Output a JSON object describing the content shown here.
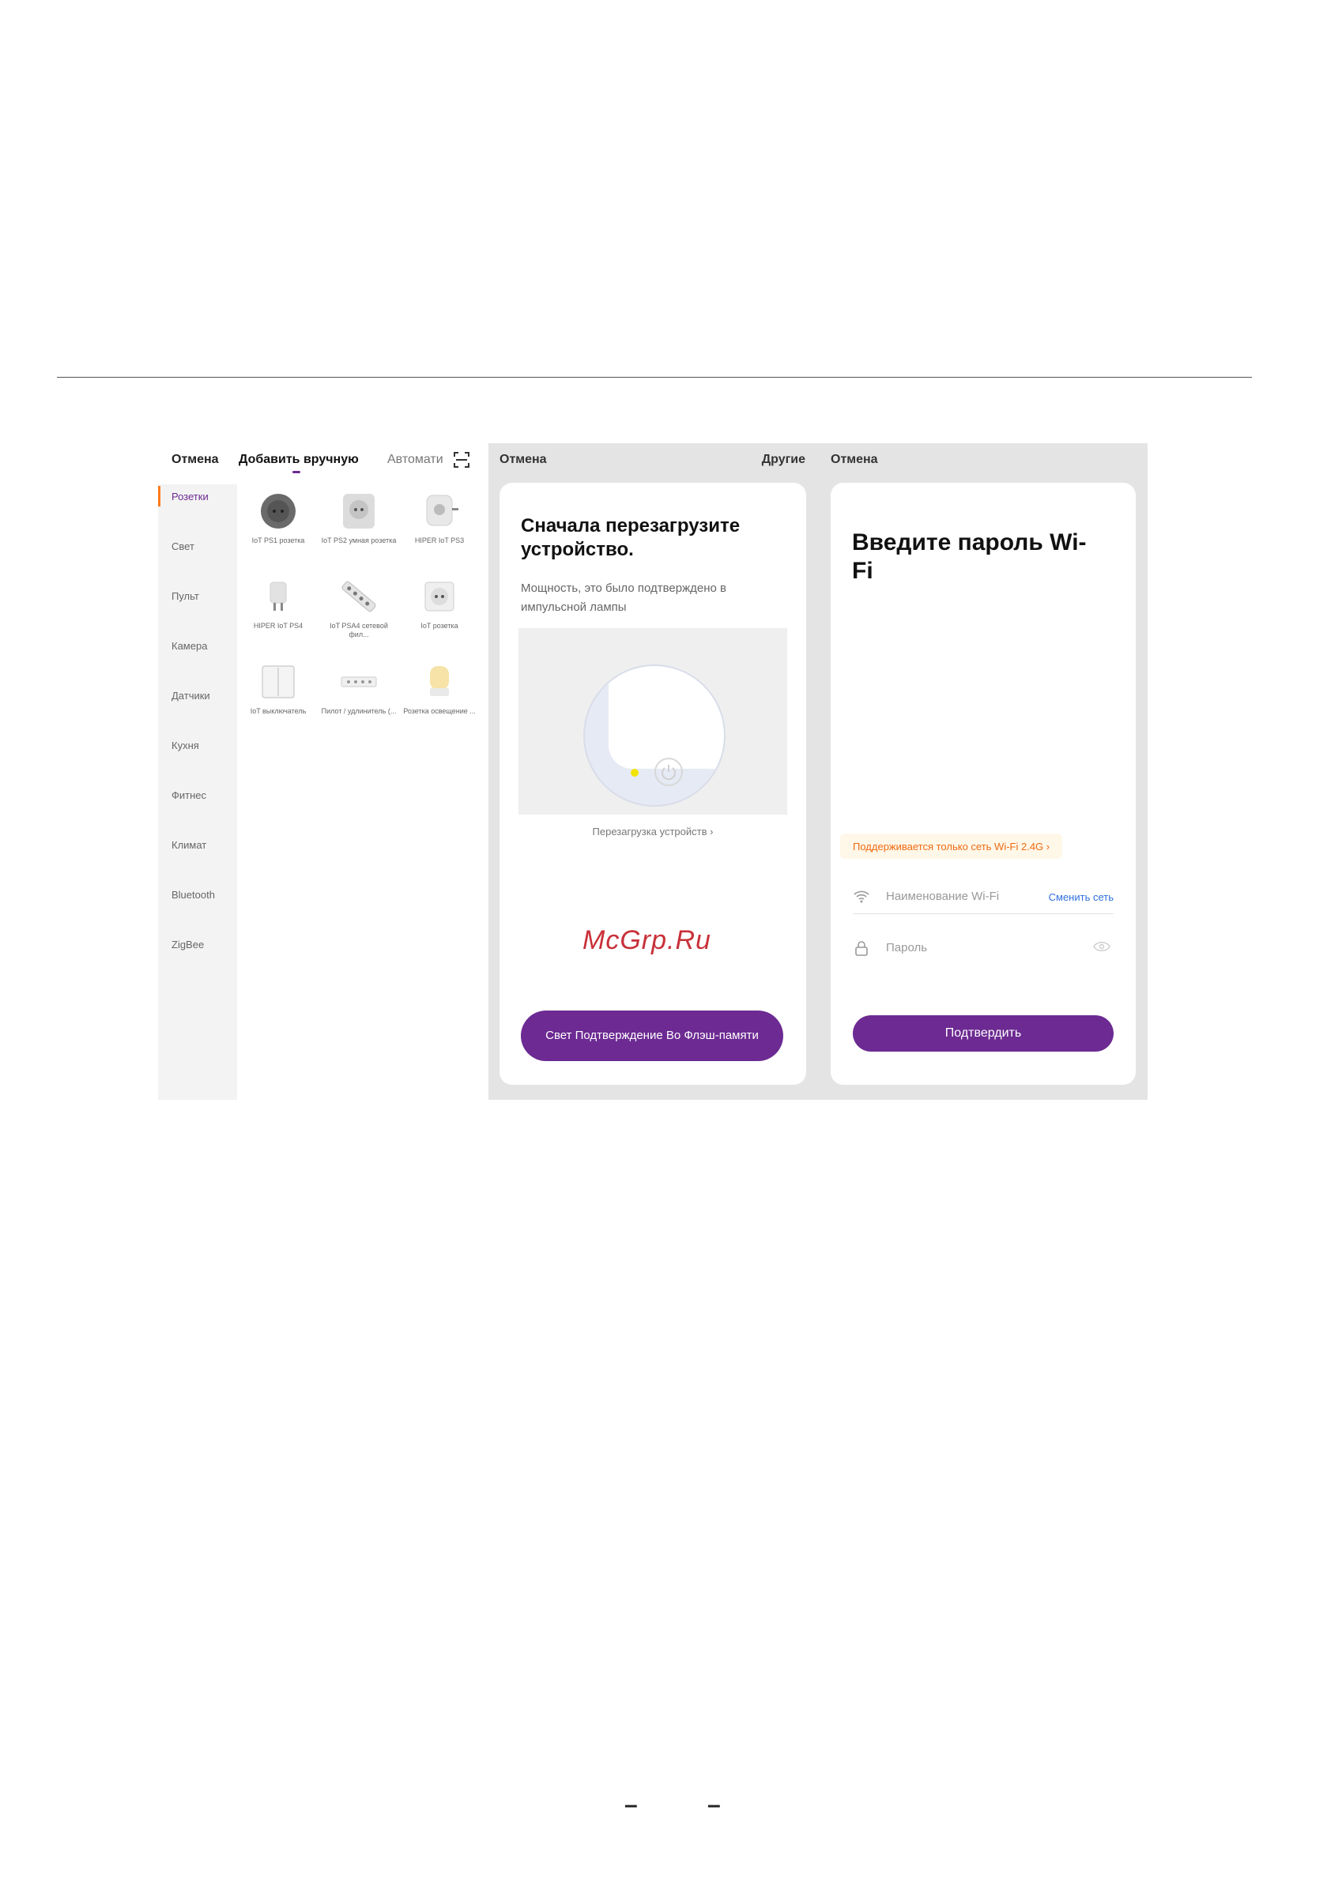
{
  "page": {
    "page_number": "– –"
  },
  "screen_select": {
    "cancel": "Отмена",
    "tab_manual": "Добавить вручную",
    "tab_auto": "Автомати",
    "categories": [
      "Розетки",
      "Свет",
      "Пульт",
      "Камера",
      "Датчики",
      "Кухня",
      "Фитнес",
      "Климат",
      "Bluetooth",
      "ZigBee"
    ],
    "devices": [
      {
        "label": "IoT PS1 розетка",
        "icon": "round-socket-icon"
      },
      {
        "label": "IoT PS2 умная розетка",
        "icon": "socket-icon"
      },
      {
        "label": "HIPER IoT PS3",
        "icon": "plug-icon"
      },
      {
        "label": "HIPER IoT PS4",
        "icon": "plug-icon"
      },
      {
        "label": "IoT PSA4 сетевой фил...",
        "icon": "power-strip-icon"
      },
      {
        "label": "IoT розетка",
        "icon": "wall-socket-icon"
      },
      {
        "label": "IoT выключатель",
        "icon": "switch-icon"
      },
      {
        "label": "Пилот / удлинитель (...",
        "icon": "extension-icon"
      },
      {
        "label": "Розетка освещение ...",
        "icon": "lamp-icon"
      }
    ],
    "accent_color": "#6c2a92",
    "active_indicator_color": "#ff7a1a"
  },
  "screen_reset": {
    "cancel": "Отмена",
    "other": "Другие",
    "title": "Сначала перезагрузите устройство.",
    "description": "Мощность, это было подтверждено в импульсной лампы",
    "reset_link": "Перезагрузка устройств",
    "confirm_button": "Свет Подтверждение Во Флэш-памяти"
  },
  "watermark": "McGrp.Ru",
  "screen_wifi": {
    "cancel": "Отмена",
    "title": "Введите пароль Wi-Fi",
    "warning": "Поддерживается только сеть Wi-Fi 2.4G",
    "wifi_placeholder": "Наименование Wi-Fi",
    "change_network": "Сменить сеть",
    "password_placeholder": "Пароль",
    "confirm_button": "Подтвердить",
    "link_color": "#2f6fdf",
    "warning_color": "#ee6b13"
  }
}
